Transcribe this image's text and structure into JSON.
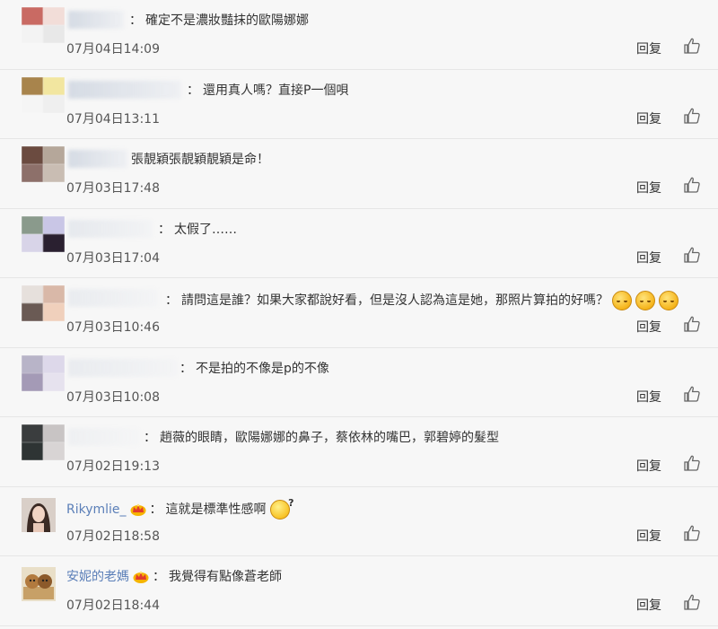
{
  "ui": {
    "reply_label": "回复"
  },
  "comments": [
    {
      "username": "",
      "comment": "確定不是濃妝豔抹的歐陽娜娜",
      "time": "07月04日14:09"
    },
    {
      "username": "",
      "comment": "還用真人嗎？直接P一個唄",
      "time": "07月04日13:11"
    },
    {
      "username": "",
      "comment": "張靚穎張靚穎靚穎是命！",
      "time": "07月03日17:48"
    },
    {
      "username": "",
      "comment": "太假了……",
      "time": "07月03日17:04"
    },
    {
      "username": "",
      "comment": "請問這是誰？如果大家都說好看，但是沒人認為這是她，那照片算拍的好嗎？",
      "time": "07月03日10:46"
    },
    {
      "username": "",
      "comment": "不是拍的不像是p的不像",
      "time": "07月03日10:08"
    },
    {
      "username": "",
      "comment": "趙薇的眼睛，歐陽娜娜的鼻子，蔡依林的嘴巴，郭碧婷的髮型",
      "time": "07月02日19:13"
    },
    {
      "username": "Rikymlie_",
      "comment": "這就是標準性感啊",
      "time": "07月02日18:58"
    },
    {
      "username": "安妮的老媽",
      "comment": "我覺得有點像蒼老師",
      "time": "07月02日18:44"
    }
  ],
  "colors": {
    "username": "#5b7fb8",
    "background": "#f7f7f7",
    "divider": "#e6e6e6"
  },
  "icons": [
    "thumbs-up-icon",
    "vip-crown-icon",
    "sad-face-emoji-icon",
    "thinking-face-emoji-icon"
  ]
}
